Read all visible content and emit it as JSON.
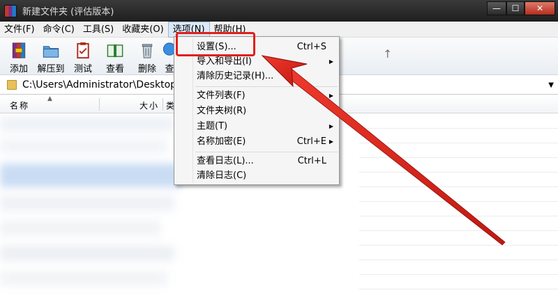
{
  "window": {
    "title": "新建文件夹 (评估版本)",
    "min_label": "—",
    "max_label": "☐",
    "close_label": "✕"
  },
  "menubar": {
    "items": [
      "文件(F)",
      "命令(C)",
      "工具(S)",
      "收藏夹(O)",
      "选项(N)",
      "帮助(H)"
    ]
  },
  "toolbar": {
    "buttons": [
      "添加",
      "解压到",
      "测试",
      "查看",
      "删除",
      "查"
    ]
  },
  "address": {
    "path": "C:\\Users\\Administrator\\Desktop\\"
  },
  "columns": {
    "name": "名称",
    "size": "大小",
    "type": "类"
  },
  "options_menu": {
    "items": [
      {
        "label": "设置(S)...",
        "shortcut": "Ctrl+S",
        "submenu": false
      },
      {
        "label": "导入和导出(I)",
        "shortcut": "",
        "submenu": true
      },
      {
        "label": "清除历史记录(H)...",
        "shortcut": "",
        "submenu": false
      },
      {
        "label": "文件列表(F)",
        "shortcut": "",
        "submenu": true
      },
      {
        "label": "文件夹树(R)",
        "shortcut": "",
        "submenu": false
      },
      {
        "label": "主题(T)",
        "shortcut": "",
        "submenu": true
      },
      {
        "label": "名称加密(E)",
        "shortcut": "Ctrl+E",
        "submenu": true
      },
      {
        "label": "查看日志(L)...",
        "shortcut": "Ctrl+L",
        "submenu": false
      },
      {
        "label": "清除日志(C)",
        "shortcut": "",
        "submenu": false
      }
    ],
    "submenu_glyph": "▶"
  },
  "colors": {
    "highlight": "#e0201c",
    "menu_active": "#dce8f6"
  }
}
